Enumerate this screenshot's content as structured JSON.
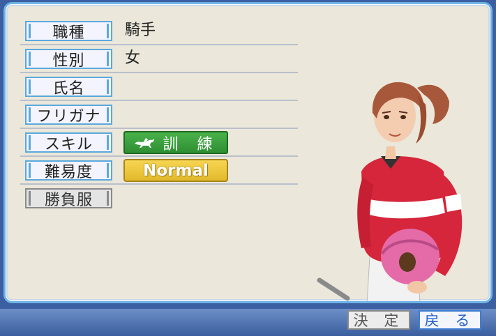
{
  "fields": [
    {
      "label": "職種",
      "value": "騎手",
      "enabled": true
    },
    {
      "label": "性別",
      "value": "女",
      "enabled": true
    },
    {
      "label": "氏名",
      "value": "",
      "enabled": true
    },
    {
      "label": "フリガナ",
      "value": "",
      "enabled": true
    },
    {
      "label": "スキル",
      "value": "",
      "enabled": true
    },
    {
      "label": "難易度",
      "value": "",
      "enabled": true
    },
    {
      "label": "勝負服",
      "value": "",
      "enabled": false
    }
  ],
  "skill": {
    "label": "訓 練",
    "icon": "horse-icon",
    "color": "#3ca33f"
  },
  "difficulty": {
    "label": "Normal",
    "color": "#f0c940"
  },
  "buttons": {
    "confirm": "決 定",
    "back": "戻 る"
  }
}
